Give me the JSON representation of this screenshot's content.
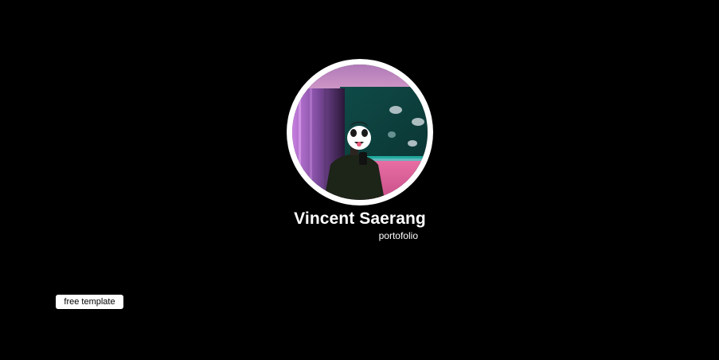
{
  "profile": {
    "name": "Vincent Saerang",
    "subtitle": "portofolio"
  },
  "actions": {
    "template_label": "free template"
  },
  "colors": {
    "background": "#000000",
    "text": "#ffffff",
    "avatar_ring": "#ffffff",
    "button_bg": "#ffffff",
    "button_text": "#000000"
  }
}
